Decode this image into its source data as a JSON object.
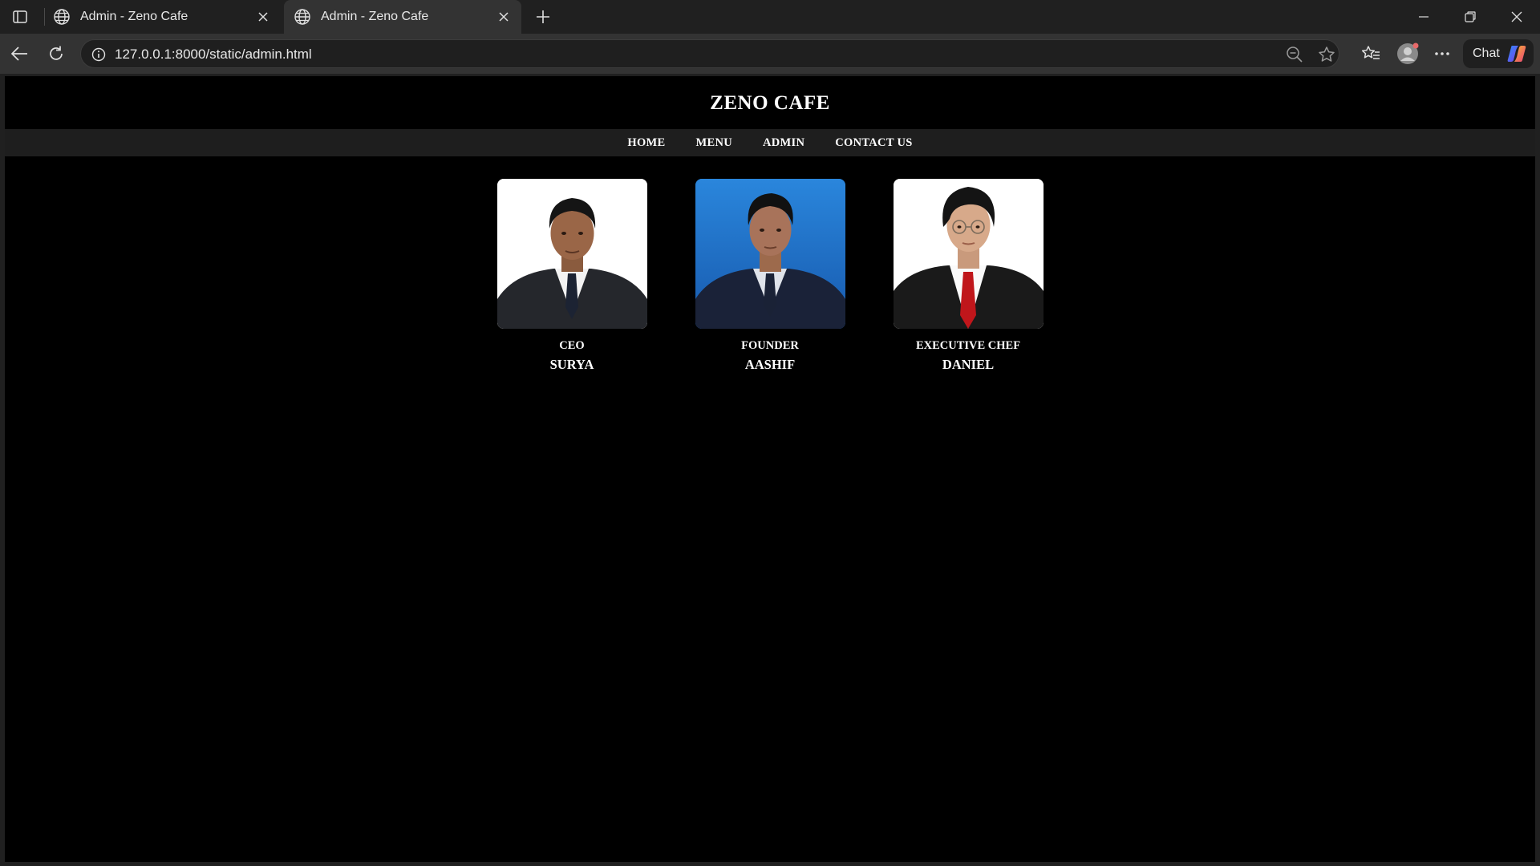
{
  "browser": {
    "tabs": [
      {
        "title": "Admin - Zeno Cafe",
        "active": false
      },
      {
        "title": "Admin - Zeno Cafe",
        "active": true
      }
    ],
    "url": "127.0.0.1:8000/static/admin.html",
    "chat_label": "Chat"
  },
  "site": {
    "title": "ZENO CAFE",
    "nav": [
      "HOME",
      "MENU",
      "ADMIN",
      "CONTACT US"
    ]
  },
  "team": [
    {
      "role": "CEO",
      "name": "SURYA",
      "photo_background": "#ffffff",
      "tie_color": "#1c2333"
    },
    {
      "role": "FOUNDER",
      "name": "AASHIF",
      "photo_background": "#1b6ec9",
      "tie_color": "#1a2236"
    },
    {
      "role": "EXECUTIVE CHEF",
      "name": "DANIEL",
      "photo_background": "#ffffff",
      "tie_color": "#c0161b"
    }
  ],
  "colors": {
    "page_background": "#000000",
    "nav_background": "#1e1e1e",
    "browser_chrome": "#202020",
    "toolbar": "#333333"
  },
  "icons": [
    "sidebar-toggle-icon",
    "globe-icon",
    "close-icon",
    "new-tab-icon",
    "minimize-icon",
    "restore-icon",
    "window-close-icon",
    "back-icon",
    "reload-icon",
    "site-info-icon",
    "zoom-out-icon",
    "favorite-star-icon",
    "favorites-icon",
    "profile-icon",
    "more-icon",
    "copilot-icon"
  ]
}
